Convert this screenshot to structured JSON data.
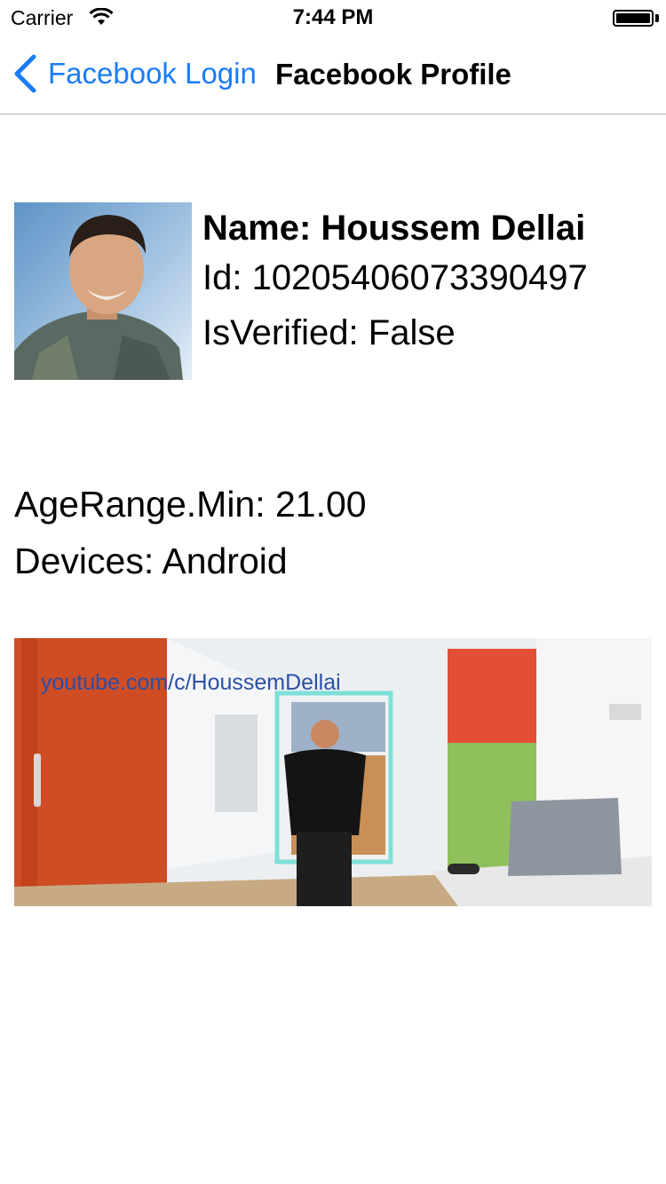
{
  "status_bar": {
    "carrier": "Carrier",
    "time": "7:44 PM"
  },
  "nav": {
    "back_label": "Facebook Login",
    "title": "Facebook Profile"
  },
  "profile": {
    "name": "Name: Houssem Dellai",
    "id": "Id: 10205406073390497",
    "verified": "IsVerified: False"
  },
  "details": {
    "age_range": "AgeRange.Min: 21.00",
    "devices": "Devices: Android"
  },
  "video": {
    "caption": "youtube.com/c/HoussemDellai"
  },
  "colors": {
    "accent": "#1a7cf5",
    "separator": "#b2b2b2"
  }
}
